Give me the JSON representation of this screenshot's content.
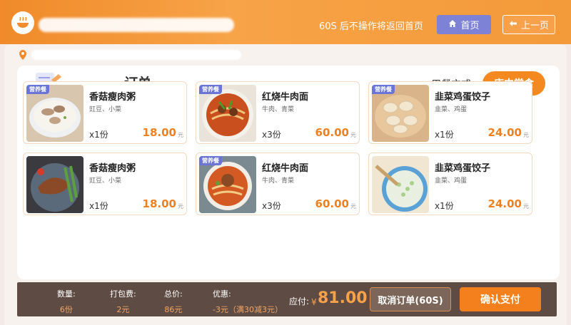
{
  "header": {
    "timeout_text": "60S 后不操作将返回首页",
    "home_label": "首页",
    "back_label": "上一页"
  },
  "order": {
    "title": "订单",
    "dine_label": "用餐方式:",
    "dine_option": "店内堂食"
  },
  "items": [
    {
      "name": "香菇瘦肉粥",
      "sub": "豇豆、小菜",
      "qty": "x1份",
      "price": "18.00",
      "unit": "元",
      "badge": "营养餐",
      "thumb": "congee"
    },
    {
      "name": "红烧牛肉面",
      "sub": "牛肉、青菜",
      "qty": "x3份",
      "price": "60.00",
      "unit": "元",
      "badge": "营养餐",
      "thumb": "noodles"
    },
    {
      "name": "韭菜鸡蛋饺子",
      "sub": "韭菜、鸡蛋",
      "qty": "x1份",
      "price": "24.00",
      "unit": "元",
      "badge": "营养餐",
      "thumb": "dumplings"
    },
    {
      "name": "香菇瘦肉粥",
      "sub": "豇豆、小菜",
      "qty": "x1份",
      "price": "18.00",
      "unit": "元",
      "badge": "",
      "thumb": "meat"
    },
    {
      "name": "红烧牛肉面",
      "sub": "牛肉、青菜",
      "qty": "x3份",
      "price": "60.00",
      "unit": "元",
      "badge": "营养餐",
      "thumb": "noodles2"
    },
    {
      "name": "韭菜鸡蛋饺子",
      "sub": "韭菜、鸡蛋",
      "qty": "x1份",
      "price": "24.00",
      "unit": "元",
      "badge": "",
      "thumb": "porridge"
    }
  ],
  "footer": {
    "count_label": "数量:",
    "count_value": "6份",
    "pack_label": "打包费:",
    "pack_value": "2元",
    "total_label": "总价:",
    "total_value": "86元",
    "discount_label": "优惠:",
    "discount_value": "-3元（满30减3元）",
    "pay_label": "应付:",
    "pay_yen": "¥",
    "pay_amount": "81.00",
    "cancel_label": "取消订单(60S)",
    "confirm_label": "确认支付"
  },
  "colors": {
    "accent": "#f3891f",
    "header": "#f39a3a",
    "home_button": "#7e82d6",
    "footer_bg": "#5e4c44",
    "price": "#f0801e",
    "badge": "#6b75d8"
  },
  "icons": {
    "logo": "bowl-logo-icon",
    "home": "home-icon",
    "back": "back-arrow-icon",
    "order": "order-list-icon",
    "address": "location-pin-icon"
  }
}
